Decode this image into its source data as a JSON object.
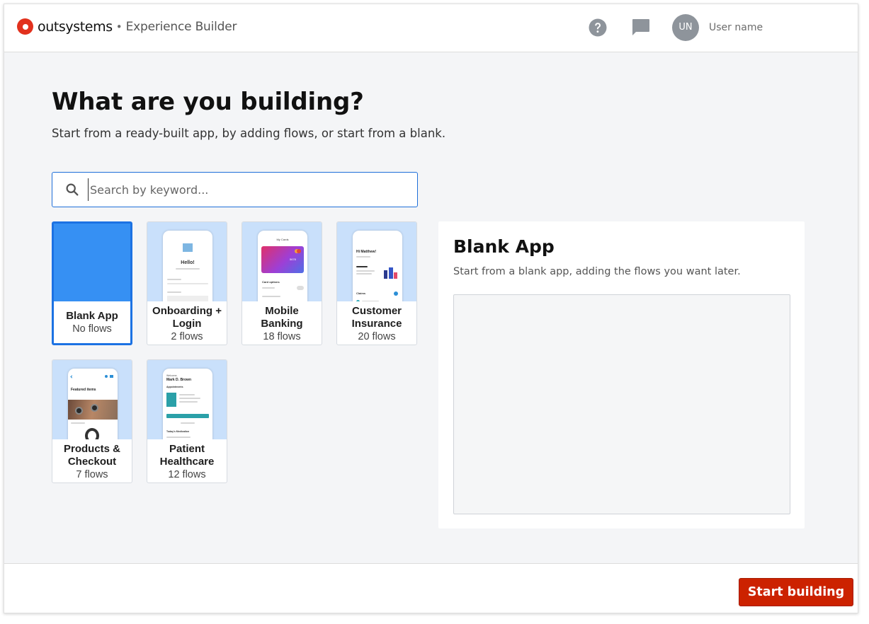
{
  "header": {
    "brand": "outsystems",
    "separator": "•",
    "product": "Experience Builder",
    "avatar_initials": "UN",
    "username": "User name",
    "icons": [
      "help-icon",
      "chat-icon"
    ]
  },
  "main": {
    "title": "What are you building?",
    "subtitle": "Start from a ready-built app, by adding flows, or start from a blank.",
    "search_placeholder": "Search by keyword...",
    "search_value": ""
  },
  "cards": [
    {
      "name": "Blank App",
      "flows": "No flows",
      "selected": true
    },
    {
      "name": "Onboarding + Login",
      "flows": "2 flows",
      "selected": false
    },
    {
      "name": "Mobile Banking",
      "flows": "18 flows",
      "selected": false
    },
    {
      "name": "Customer Insurance",
      "flows": "20 flows",
      "selected": false
    },
    {
      "name": "Products & Checkout",
      "flows": "7 flows",
      "selected": false
    },
    {
      "name": "Patient Healthcare",
      "flows": "12 flows",
      "selected": false
    }
  ],
  "thumb_text": {
    "onboarding_heading": "Hello!",
    "banking_heading": "My Cards",
    "banking_card_number": "5678",
    "banking_section": "Card options",
    "insurance_greeting": "Hi Matthew!",
    "insurance_section": "Claims",
    "products_section": "Featured items",
    "patient_welcome": "Welcome,",
    "patient_name": "Mark D. Brown",
    "patient_appointments": "Appointments",
    "patient_meds": "Today's Medication"
  },
  "detail": {
    "title": "Blank App",
    "description": "Start from a blank app, adding the flows you want later."
  },
  "footer": {
    "start_label": "Start building"
  },
  "colors": {
    "brand_red": "#e2311d",
    "accent_blue": "#1c72e3",
    "button_red": "#cc2200",
    "thumb_bg": "#c9e0fb"
  }
}
